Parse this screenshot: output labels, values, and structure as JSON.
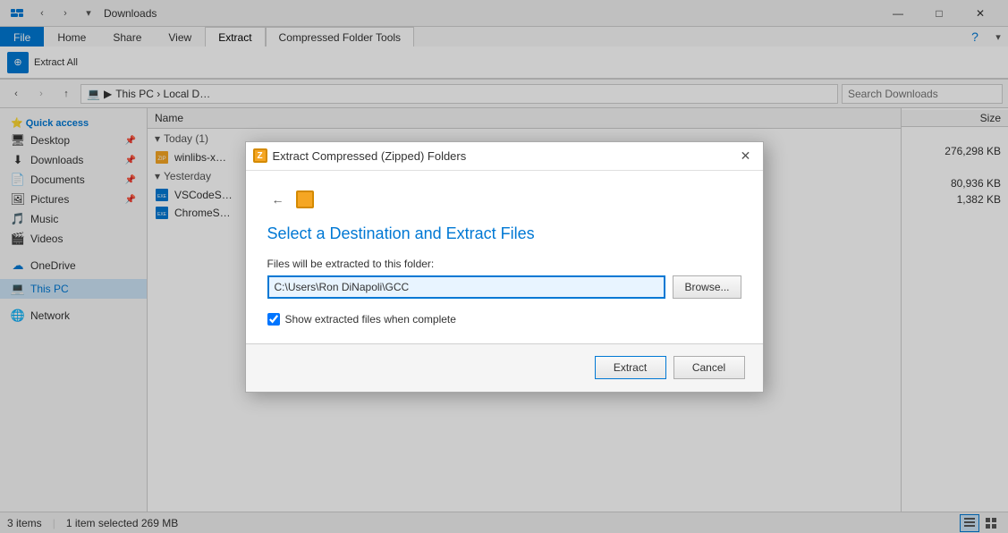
{
  "titlebar": {
    "title": "Downloads",
    "minimize_label": "—",
    "maximize_label": "□",
    "close_label": "✕"
  },
  "ribbon": {
    "tabs": [
      {
        "id": "file",
        "label": "File",
        "active": false
      },
      {
        "id": "home",
        "label": "Home",
        "active": false
      },
      {
        "id": "share",
        "label": "Share",
        "active": false
      },
      {
        "id": "view",
        "label": "View",
        "active": false
      },
      {
        "id": "extract",
        "label": "Extract",
        "active": true
      },
      {
        "id": "compressed",
        "label": "Compressed Folder Tools",
        "active": false
      }
    ]
  },
  "address_bar": {
    "path": "This PC › Local D…",
    "search_placeholder": "Search Downloads",
    "back_label": "‹",
    "forward_label": "›",
    "up_label": "↑"
  },
  "sidebar": {
    "items": [
      {
        "id": "quick-access",
        "label": "Quick access",
        "icon": "⭐",
        "section": true
      },
      {
        "id": "desktop",
        "label": "Desktop",
        "icon": "🖥",
        "pinned": true
      },
      {
        "id": "downloads",
        "label": "Downloads",
        "icon": "⬇",
        "pinned": true
      },
      {
        "id": "documents",
        "label": "Documents",
        "icon": "📄",
        "pinned": true
      },
      {
        "id": "pictures",
        "label": "Pictures",
        "icon": "🖼",
        "pinned": true
      },
      {
        "id": "music",
        "label": "Music",
        "icon": "🎵"
      },
      {
        "id": "videos",
        "label": "Videos",
        "icon": "🎬"
      },
      {
        "id": "onedrive",
        "label": "OneDrive",
        "icon": "☁",
        "section_gap": true
      },
      {
        "id": "this-pc",
        "label": "This PC",
        "icon": "💻",
        "active": true
      },
      {
        "id": "network",
        "label": "Network",
        "icon": "🌐",
        "section_gap": true
      }
    ]
  },
  "file_list": {
    "columns": [
      {
        "id": "name",
        "label": "Name"
      },
      {
        "id": "size",
        "label": "Size"
      }
    ],
    "groups": [
      {
        "label": "Today (1)",
        "items": [
          {
            "name": "winlibs-x…",
            "icon": "zip",
            "size": "276,298 KB"
          }
        ]
      },
      {
        "label": "Yesterday",
        "items": [
          {
            "name": "VSCodeS…",
            "icon": "exe",
            "size": "80,936 KB"
          },
          {
            "name": "ChromeS…",
            "icon": "exe",
            "size": "1,382 KB"
          }
        ]
      }
    ]
  },
  "status_bar": {
    "items_count": "3 items",
    "selection": "1 item selected  269 MB"
  },
  "dialog": {
    "title": "Extract Compressed (Zipped) Folders",
    "heading": "Select a Destination and Extract Files",
    "folder_label": "Files will be extracted to this folder:",
    "path_value": "C:\\Users\\Ron DiNapoli\\GCC",
    "browse_label": "Browse...",
    "checkbox_label": "Show extracted files when complete",
    "checkbox_checked": true,
    "extract_label": "Extract",
    "cancel_label": "Cancel",
    "back_label": "←",
    "close_label": "✕"
  }
}
